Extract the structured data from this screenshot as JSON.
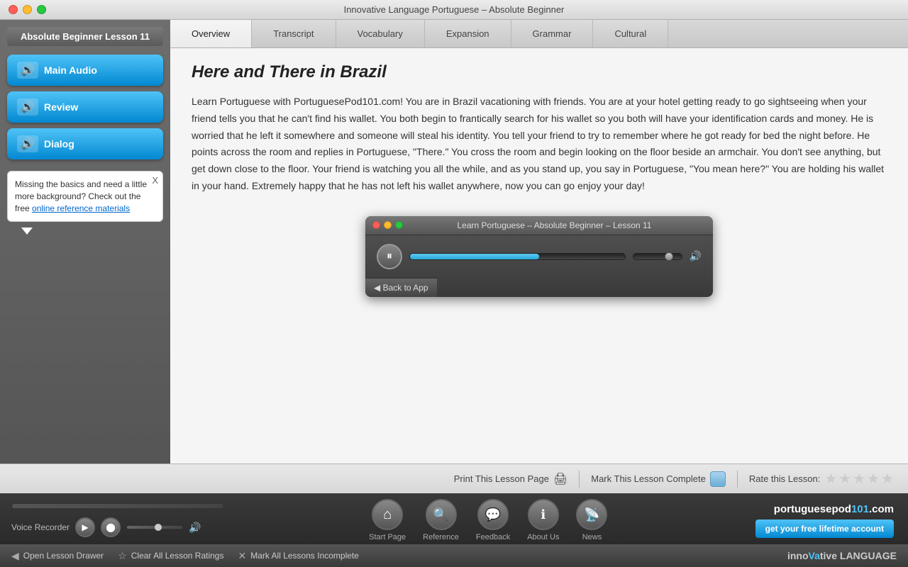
{
  "titlebar": {
    "title": "Innovative Language Portuguese – Absolute Beginner"
  },
  "sidebar": {
    "lesson_title": "Absolute Beginner Lesson 11",
    "buttons": [
      {
        "id": "main-audio",
        "label": "Main Audio"
      },
      {
        "id": "review",
        "label": "Review"
      },
      {
        "id": "dialog",
        "label": "Dialog"
      }
    ],
    "info_box": {
      "text": "Missing the basics and need a little more background? Check out the free",
      "link_text": "online reference materials"
    }
  },
  "tabs": [
    {
      "id": "overview",
      "label": "Overview",
      "active": true
    },
    {
      "id": "transcript",
      "label": "Transcript"
    },
    {
      "id": "vocabulary",
      "label": "Vocabulary"
    },
    {
      "id": "expansion",
      "label": "Expansion"
    },
    {
      "id": "grammar",
      "label": "Grammar"
    },
    {
      "id": "cultural",
      "label": "Cultural"
    }
  ],
  "lesson": {
    "title": "Here and There in Brazil",
    "body": "Learn Portuguese with PortuguesePod101.com! You are in Brazil vacationing with friends. You are at your hotel getting ready to go sightseeing when your friend tells you that he can't find his wallet. You both begin to frantically search for his wallet so you both will have your identification cards and money. He is worried that he left it somewhere and someone will steal his identity. You tell your friend to try to remember where he got ready for bed the night before. He points across the room and replies in Portuguese, \"There.\" You cross the room and begin looking on the floor beside an armchair. You don't see anything, but get down close to the floor. Your friend is watching you all the while, and as you stand up, you say in Portuguese, \"You mean here?\" You are holding his wallet in your hand. Extremely happy that he has not left his wallet anywhere, now you can go enjoy your day!"
  },
  "audio_player": {
    "title": "Learn Portuguese – Absolute Beginner – Lesson 11",
    "progress": 60,
    "back_label": "◀ Back to App"
  },
  "bottom_bar": {
    "print_label": "Print This Lesson Page",
    "mark_label": "Mark This Lesson Complete",
    "rate_label": "Rate this Lesson:"
  },
  "footer": {
    "voice_recorder_label": "Voice Recorder",
    "icons": [
      {
        "id": "start-page",
        "symbol": "⌂",
        "label": "Start Page"
      },
      {
        "id": "reference",
        "symbol": "◎",
        "label": "Reference"
      },
      {
        "id": "feedback",
        "symbol": "◉",
        "label": "Feedback"
      },
      {
        "id": "about-us",
        "symbol": "ℹ",
        "label": "About Us"
      },
      {
        "id": "news",
        "symbol": "◈",
        "label": "News"
      }
    ],
    "brand_url_prefix": "portuguesepod",
    "brand_url_suffix": "101.com",
    "get_account_label": "get your free lifetime account"
  },
  "very_bottom": {
    "actions": [
      {
        "id": "open-lesson-drawer",
        "icon": "◀",
        "label": "Open Lesson Drawer"
      },
      {
        "id": "clear-ratings",
        "icon": "☆",
        "label": "Clear All Lesson Ratings"
      },
      {
        "id": "mark-incomplete",
        "icon": "✕",
        "label": "Mark All Lessons Incomplete"
      }
    ],
    "brand_prefix": "inno",
    "brand_highlight": "Va",
    "brand_suffix": "tive LANGUAGE"
  }
}
